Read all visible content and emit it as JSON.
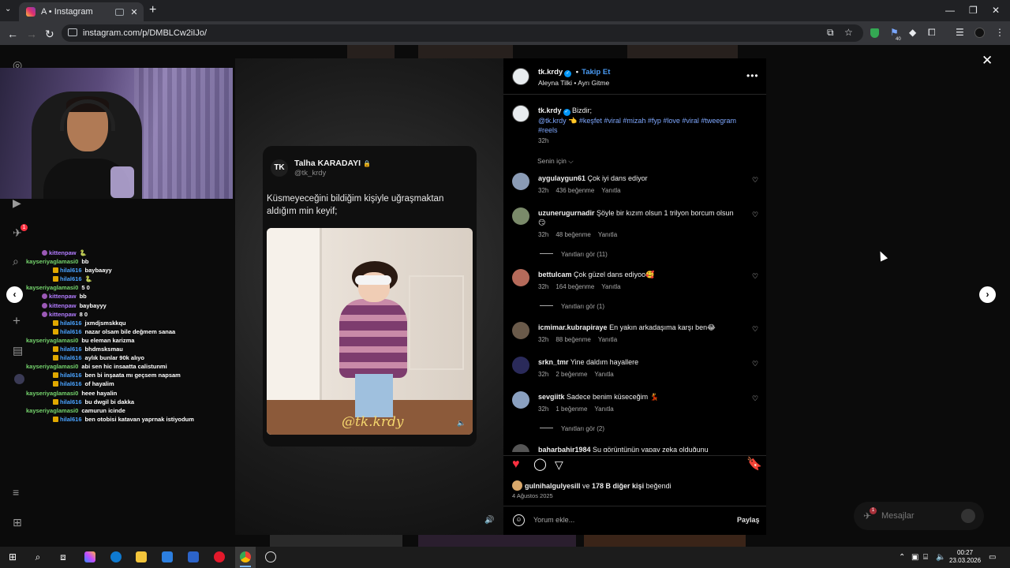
{
  "browser": {
    "tab_title": "A • Instagram",
    "tab_close": "✕",
    "new_tab": "+",
    "url": "instagram.com/p/DMBLCw2iIJo/",
    "window_min": "—",
    "window_max": "❐",
    "window_close": "✕",
    "ext_badge": "40"
  },
  "sidebar": {
    "notifications_badge": "1"
  },
  "chat": [
    {
      "user": "kittenpaw",
      "msg": "🐍",
      "color": "purple",
      "indent": "indent2"
    },
    {
      "user": "kayseriyaglamasi0",
      "msg": "bb",
      "color": "green",
      "indent": ""
    },
    {
      "user": "hilal616",
      "msg": "baybaayy",
      "color": "blue",
      "indent": "indent"
    },
    {
      "user": "hilal616",
      "msg": "🐍",
      "color": "blue",
      "indent": "indent"
    },
    {
      "user": "kayseriyaglamasi0",
      "msg": "5 0",
      "color": "green",
      "indent": ""
    },
    {
      "user": "kittenpaw",
      "msg": "bb",
      "color": "purple",
      "indent": "indent2"
    },
    {
      "user": "kittenpaw",
      "msg": "baybayyy",
      "color": "purple",
      "indent": "indent2"
    },
    {
      "user": "kittenpaw",
      "msg": "8 0",
      "color": "purple",
      "indent": "indent2"
    },
    {
      "user": "hilal616",
      "msg": "jxmdjsmskkqu",
      "color": "blue",
      "indent": "indent"
    },
    {
      "user": "hilal616",
      "msg": "nazar olsam bile değmem sanaa",
      "color": "blue",
      "indent": "indent"
    },
    {
      "user": "kayseriyaglamasi0",
      "msg": "bu eleman karizma",
      "color": "green",
      "indent": ""
    },
    {
      "user": "hilal616",
      "msg": "bhdmsksmau",
      "color": "blue",
      "indent": "indent"
    },
    {
      "user": "hilal616",
      "msg": "aylık bunlar 90k alıyo",
      "color": "blue",
      "indent": "indent"
    },
    {
      "user": "kayseriyaglamasi0",
      "msg": "abi sen hic insaatta calistunmi",
      "color": "green",
      "indent": ""
    },
    {
      "user": "hilal616",
      "msg": "ben bi inşaata mı geçsem napsam",
      "color": "blue",
      "indent": "indent"
    },
    {
      "user": "hilal616",
      "msg": "of hayalim",
      "color": "blue",
      "indent": "indent"
    },
    {
      "user": "kayseriyaglamasi0",
      "msg": "heee hayalin",
      "color": "green",
      "indent": ""
    },
    {
      "user": "hilal616",
      "msg": "bu dwgil bi dakka",
      "color": "blue",
      "indent": "indent"
    },
    {
      "user": "kayseriyaglamasi0",
      "msg": "camurun icinde",
      "color": "green",
      "indent": ""
    },
    {
      "user": "hilal616",
      "msg": "ben otobisi katavan yaprnak istiyodum",
      "color": "blue",
      "indent": "indent"
    }
  ],
  "media": {
    "tweet_name": "Talha KARADAYI",
    "tweet_handle": "@tk_krdy",
    "tweet_text": "Küsmeyeceğini bildiğim kişiyle uğraşmaktan aldığım min keyif;",
    "logo": "TK",
    "watermark": "@tk.krdy"
  },
  "post": {
    "username": "tk.krdy",
    "follow": "Takip Et",
    "separator": "•",
    "subtitle": "Aleyna Tilki • Ayrı Gitme",
    "caption_user": "tk.krdy",
    "caption_text": "Bizdir;",
    "caption_tags": "@tk.krdy 👈 #keşfet #viral #mizah #fyp #love #viral #tweegram #reels",
    "caption_time": "32h",
    "sort_label": "Senin için ⌵",
    "likes_user": "gulnihalgulyesill",
    "likes_mid": " ve ",
    "likes_rest": "178 B diğer kişi",
    "likes_end": " beğendi",
    "date": "4 Ağustos 2025",
    "comment_placeholder": "Yorum ekle...",
    "post_button": "Paylaş"
  },
  "comments": [
    {
      "user": "aygulaygun61",
      "text": " Çok iyi dans ediyor",
      "time": "32h",
      "likes": "436 beğenme",
      "reply": "Yanıtla",
      "avcolor": "#8a9bb5"
    },
    {
      "user": "uzunerugurnadir",
      "text": " Şöyle bir kızım olsun 1 trilyon borcum olsun 😏",
      "time": "32h",
      "likes": "48 beğenme",
      "reply": "Yanıtla",
      "avcolor": "#7a8a6a"
    },
    {
      "user": "bettulcam",
      "text": " Çok güzel dans ediyoo🥰",
      "time": "32h",
      "likes": "164 beğenme",
      "reply": "Yanıtla",
      "avcolor": "#b56a5a"
    },
    {
      "user": "icmimar.kubrapiraye",
      "text": " En yakın arkadaşıma karşı ben😂",
      "time": "32h",
      "likes": "88 beğenme",
      "reply": "Yanıtla",
      "avcolor": "#6a5a4a"
    },
    {
      "user": "srkn_tmr",
      "text": " Yine daldım hayallere",
      "time": "32h",
      "likes": "2 beğenme",
      "reply": "Yanıtla",
      "avcolor": "#2a2a5a"
    },
    {
      "user": "sevgiitk",
      "text": " Sadece benim küseceğim 💃",
      "time": "32h",
      "likes": "1 beğenme",
      "reply": "Yanıtla",
      "avcolor": "#8aa0c0"
    },
    {
      "user": "baharbahir1984",
      "text": " Şu görüntünün yapay zeka olduğunu",
      "time": "",
      "likes": "",
      "reply": "",
      "avcolor": "#555"
    }
  ],
  "replies": {
    "r1": "Yanıtları gör (11)",
    "r2": "Yanıtları gör (1)",
    "r3": "Yanıtları gör (2)"
  },
  "messages": {
    "label": "Mesajlar",
    "badge": "1"
  },
  "taskbar": {
    "time": "00:27",
    "date": "23.03.2026"
  },
  "colors": {
    "follow_blue": "#4a9cf6",
    "like_red": "#ff3040",
    "verified_blue": "#0095f6"
  }
}
